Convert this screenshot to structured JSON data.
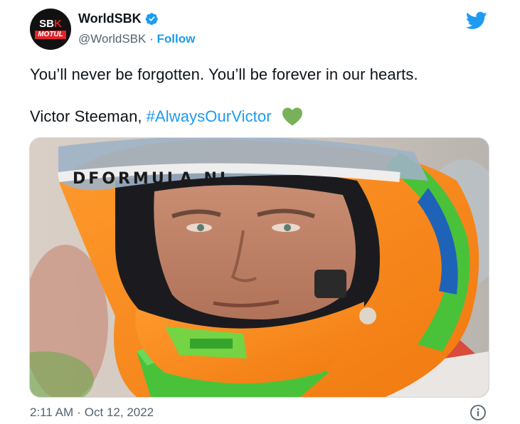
{
  "account": {
    "display_name": "WorldSBK",
    "handle": "@WorldSBK",
    "separator": "·",
    "follow_label": "Follow",
    "avatar_text_left": "SB",
    "avatar_text_right": "K",
    "avatar_sponsor": "MOTUL"
  },
  "tweet": {
    "line1": "You’ll never be forgotten. You’ll be forever in our hearts.",
    "line2_text": "Victor Steeman,",
    "hashtag": "#AlwaysOurVictor"
  },
  "photo": {
    "visor_text": "DFORMULA.NL"
  },
  "footer": {
    "time": "2:11 AM",
    "separator": "·",
    "date": "Oct 12, 2022"
  },
  "icons": {
    "verified": "verified-badge-icon",
    "platform": "twitter-bird-icon",
    "heart": "green-heart-icon",
    "info": "info-icon"
  },
  "colors": {
    "accent": "#1d9bf0",
    "text": "#0f1419",
    "muted": "#536471",
    "heart": "#78b159"
  }
}
